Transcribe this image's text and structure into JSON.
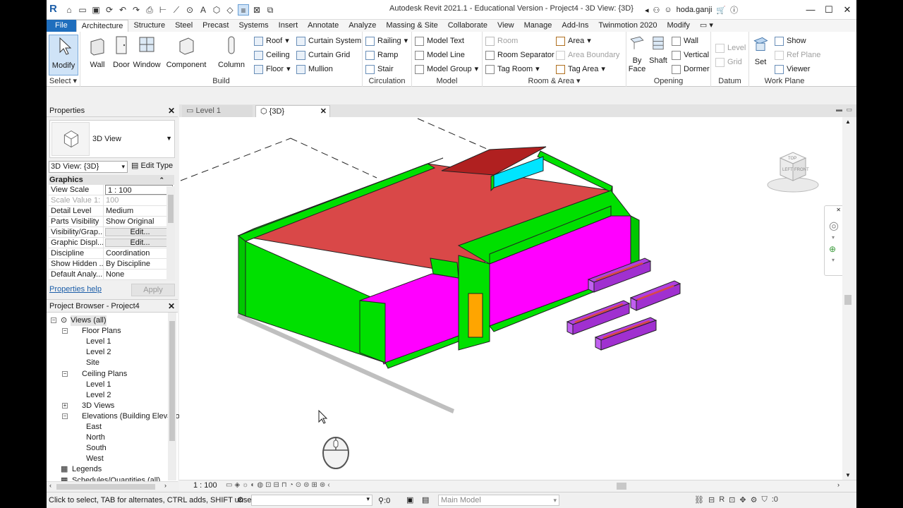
{
  "titlebar": {
    "title": "Autodesk Revit 2021.1 - Educational Version - Project4 - 3D View: {3D}",
    "username": "hoda.ganji"
  },
  "tabs": [
    "File",
    "Architecture",
    "Structure",
    "Steel",
    "Precast",
    "Systems",
    "Insert",
    "Annotate",
    "Analyze",
    "Massing & Site",
    "Collaborate",
    "View",
    "Manage",
    "Add-Ins",
    "Twinmotion 2020",
    "Modify"
  ],
  "active_tab": "Architecture",
  "ribbon": {
    "select": {
      "modify": "Modify",
      "panel": "Select ▾"
    },
    "build": {
      "panel": "Build",
      "wall": "Wall",
      "door": "Door",
      "window": "Window",
      "component": "Component",
      "column": "Column",
      "roof": "Roof",
      "ceiling": "Ceiling",
      "floor": "Floor",
      "curtain_system": "Curtain System",
      "curtain_grid": "Curtain Grid",
      "mullion": "Mullion"
    },
    "circulation": {
      "panel": "Circulation",
      "railing": "Railing",
      "ramp": "Ramp",
      "stair": "Stair"
    },
    "model": {
      "panel": "Model",
      "model_text": "Model Text",
      "model_line": "Model Line",
      "model_group": "Model Group"
    },
    "room_area": {
      "panel": "Room & Area ▾",
      "room": "Room",
      "room_separator": "Room Separator",
      "tag_room": "Tag Room",
      "area": "Area",
      "area_boundary": "Area Boundary",
      "tag_area": "Tag Area"
    },
    "opening": {
      "panel": "Opening",
      "by_face": "By Face",
      "shaft": "Shaft",
      "wall": "Wall",
      "vertical": "Vertical",
      "dormer": "Dormer"
    },
    "datum": {
      "panel": "Datum",
      "level": "Level",
      "grid": "Grid"
    },
    "work_plane": {
      "panel": "Work Plane",
      "set": "Set",
      "show": "Show",
      "ref_plane": "Ref Plane",
      "viewer": "Viewer"
    }
  },
  "properties": {
    "title": "Properties",
    "type_name": "3D View",
    "instance": "3D View: {3D}",
    "edit_type": "Edit Type",
    "section": "Graphics",
    "rows": [
      {
        "k": "View Scale",
        "v": "1 : 100"
      },
      {
        "k": "Scale Value    1:",
        "v": "100"
      },
      {
        "k": "Detail Level",
        "v": "Medium"
      },
      {
        "k": "Parts Visibility",
        "v": "Show Original"
      },
      {
        "k": "Visibility/Grap...",
        "v": "Edit..."
      },
      {
        "k": "Graphic Displ...",
        "v": "Edit..."
      },
      {
        "k": "Discipline",
        "v": "Coordination"
      },
      {
        "k": "Show Hidden ...",
        "v": "By Discipline"
      },
      {
        "k": "Default Analy...",
        "v": "None"
      }
    ],
    "help": "Properties help",
    "apply": "Apply"
  },
  "browser": {
    "title": "Project Browser - Project4",
    "nodes": [
      {
        "label": "Views (all)",
        "level": 0
      },
      {
        "label": "Floor Plans",
        "level": 1
      },
      {
        "label": "Level 1",
        "level": 2
      },
      {
        "label": "Level 2",
        "level": 2
      },
      {
        "label": "Site",
        "level": 2
      },
      {
        "label": "Ceiling Plans",
        "level": 1
      },
      {
        "label": "Level 1",
        "level": 2
      },
      {
        "label": "Level 2",
        "level": 2
      },
      {
        "label": "3D Views",
        "level": 1
      },
      {
        "label": "Elevations (Building Elevation",
        "level": 1
      },
      {
        "label": "East",
        "level": 2
      },
      {
        "label": "North",
        "level": 2
      },
      {
        "label": "South",
        "level": 2
      },
      {
        "label": "West",
        "level": 2
      },
      {
        "label": "Legends",
        "level": 0
      },
      {
        "label": "Schedules/Quantities (all)",
        "level": 0
      }
    ]
  },
  "view_tabs": [
    {
      "label": "Level 1"
    },
    {
      "label": "{3D}"
    }
  ],
  "viewcube": {
    "top": "TOP",
    "left": "LEFT",
    "front": "FRONT"
  },
  "view_bar": {
    "scale": "1 : 100"
  },
  "status": {
    "message": "Click to select, TAB for alternates, CTRL adds, SHIFT unselect",
    "count": ":0",
    "model": "Main Model",
    "filter_count": ":0"
  },
  "colors": {
    "wall": "#00e000",
    "floor_roof": "#d94848",
    "room_fill": "#ff00ff",
    "door": "#ffa500",
    "glass": "#00e5ff",
    "planter": "#b040e0",
    "accent": "#1f6ebd"
  }
}
